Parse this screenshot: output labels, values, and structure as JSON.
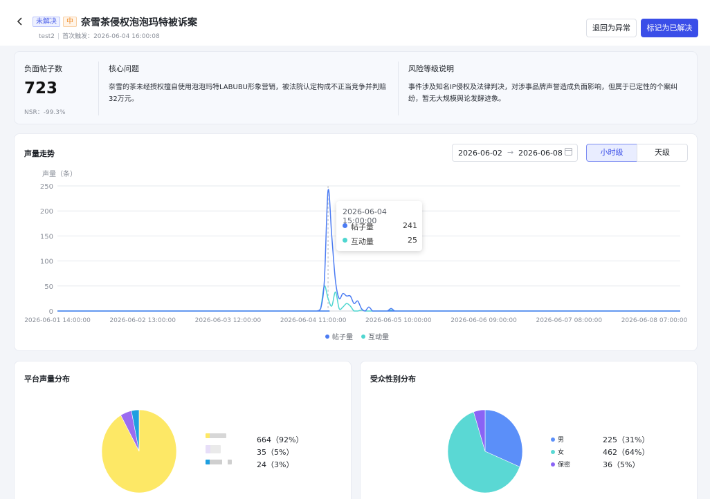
{
  "header": {
    "back_icon": "chevron-left-icon",
    "status_badge": "未解决",
    "level_badge": "中",
    "title": "奈雪茶侵权泡泡玛特被诉案",
    "author": "test2",
    "first_trigger_label": "首次触发：",
    "first_trigger_time": "2026-06-04 16:00:08",
    "revert_button": "退回为异常",
    "resolve_button": "标记为已解决",
    "colors": {
      "primary": "#3a4ee8",
      "status": "#4b5ee8",
      "level": "#f08a24"
    }
  },
  "summary": {
    "posts_label": "负面帖子数",
    "posts_value": "723",
    "nsr": "NSR：-99.3%",
    "core_label": "核心问题",
    "core_text": "奈雪的茶未经授权擅自使用泡泡玛特LABUBU形象营销，被法院认定构成不正当竞争并判赔32万元。",
    "risk_label": "风险等级说明",
    "risk_text": "事件涉及知名IP侵权及法律判决，对涉事品牌声誉造成负面影响，但属于已定性的个案纠纷，暂无大规模舆论发酵迹象。"
  },
  "trend": {
    "title": "声量走势",
    "date_from": "2026-06-02",
    "date_to": "2026-06-08",
    "range_arrow": "→",
    "calendar_icon": "calendar-icon",
    "granularity_hour": "小时级",
    "granularity_day": "天级",
    "selected_granularity": "小时级",
    "tooltip": {
      "time": "2026-06-04 15:00:00",
      "posts_label": "帖子量",
      "posts_value": "241",
      "interactions_label": "互动量",
      "interactions_value": "25"
    }
  },
  "chart_data": {
    "type": "line",
    "ylabel": "声量（条）",
    "ylim": [
      0,
      250
    ],
    "yticks": [
      "250",
      "200",
      "150",
      "100",
      "50",
      "0"
    ],
    "xlim": [
      "2026-06-01 14:00:00",
      "2026-06-08 14:00:00"
    ],
    "xticks": [
      "2026-06-01 14:00:00",
      "2026-06-02 13:00:00",
      "2026-06-03 12:00:00",
      "2026-06-04 11:00:00",
      "2026-06-05 10:00:00",
      "2026-06-06 09:00:00",
      "2026-06-07 08:00:00",
      "2026-06-08 07:00:00"
    ],
    "grid": true,
    "legend_position": "bottom",
    "series": [
      {
        "name": "帖子量",
        "color": "#4c7cf3",
        "x": [
          "2026-06-01 14:00:00",
          "2026-06-04 10:00:00",
          "2026-06-04 11:00:00",
          "2026-06-04 12:00:00",
          "2026-06-04 13:00:00",
          "2026-06-04 14:00:00",
          "2026-06-04 15:00:00",
          "2026-06-04 16:00:00",
          "2026-06-04 17:00:00",
          "2026-06-04 18:00:00",
          "2026-06-04 19:00:00",
          "2026-06-04 20:00:00",
          "2026-06-04 21:00:00",
          "2026-06-04 22:00:00",
          "2026-06-04 23:00:00",
          "2026-06-05 00:00:00",
          "2026-06-05 01:00:00",
          "2026-06-05 02:00:00",
          "2026-06-05 03:00:00",
          "2026-06-05 04:00:00",
          "2026-06-05 05:00:00",
          "2026-06-05 06:00:00",
          "2026-06-05 07:00:00",
          "2026-06-05 08:00:00",
          "2026-06-05 09:00:00",
          "2026-06-05 10:00:00",
          "2026-06-08 14:00:00"
        ],
        "values": [
          0,
          0,
          0,
          0,
          5,
          60,
          241,
          150,
          60,
          25,
          35,
          30,
          30,
          15,
          20,
          5,
          0,
          8,
          0,
          0,
          0,
          0,
          0,
          5,
          0,
          0,
          0
        ]
      },
      {
        "name": "互动量",
        "color": "#4fd6d0",
        "x": [
          "2026-06-01 14:00:00",
          "2026-06-04 10:00:00",
          "2026-06-04 11:00:00",
          "2026-06-04 12:00:00",
          "2026-06-04 13:00:00",
          "2026-06-04 14:00:00",
          "2026-06-04 15:00:00",
          "2026-06-04 16:00:00",
          "2026-06-04 17:00:00",
          "2026-06-04 18:00:00",
          "2026-06-04 19:00:00",
          "2026-06-04 20:00:00",
          "2026-06-04 21:00:00",
          "2026-06-04 22:00:00",
          "2026-06-04 23:00:00",
          "2026-06-05 00:00:00",
          "2026-06-05 01:00:00",
          "2026-06-05 02:00:00",
          "2026-06-05 03:00:00",
          "2026-06-05 04:00:00",
          "2026-06-05 05:00:00",
          "2026-06-05 06:00:00",
          "2026-06-05 07:00:00",
          "2026-06-05 08:00:00",
          "2026-06-05 09:00:00",
          "2026-06-05 10:00:00",
          "2026-06-08 14:00:00"
        ],
        "values": [
          0,
          0,
          0,
          0,
          5,
          50,
          25,
          10,
          38,
          5,
          8,
          15,
          10,
          0,
          0,
          2,
          0,
          0,
          0,
          0,
          0,
          0,
          0,
          2,
          0,
          0,
          0
        ]
      }
    ],
    "highlight_x": "2026-06-04 15:00:00"
  },
  "platform": {
    "title": "平台声量分布",
    "chart_type": "pie",
    "items": [
      {
        "value": 664,
        "text": "664（92%）",
        "color": "#fde866"
      },
      {
        "value": 35,
        "text": "35（5%）",
        "color": "#9b6cf0"
      },
      {
        "value": 24,
        "text": "24（3%）",
        "color": "#1e9fe0"
      }
    ]
  },
  "gender": {
    "title": "受众性别分布",
    "chart_type": "pie",
    "items": [
      {
        "label": "男",
        "value": 225,
        "text": "225（31%）",
        "color": "#5b8ff9"
      },
      {
        "label": "女",
        "value": 462,
        "text": "462（64%）",
        "color": "#5ad8d4"
      },
      {
        "label": "保密",
        "value": 36,
        "text": "36（5%）",
        "color": "#8a63f5"
      }
    ]
  }
}
